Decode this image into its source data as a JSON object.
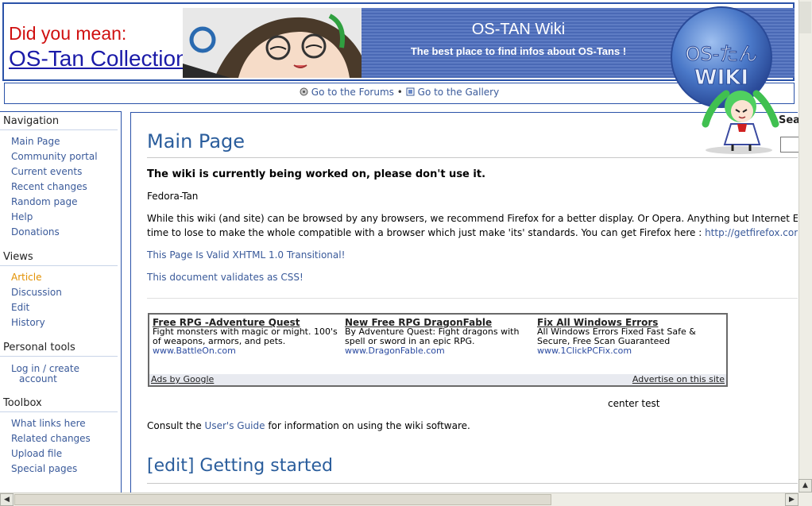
{
  "header": {
    "did_you_mean_label": "Did you mean:",
    "did_you_mean_link": "OS-Tan Collections",
    "site_title": "OS-TAN Wiki",
    "tagline": "The best place to find infos about OS-Tans !",
    "logo_text_line1": "OS-たん",
    "logo_text_line2": "WIKI"
  },
  "linkbar": {
    "forums_link": "Go to the Forums",
    "separator": "•",
    "gallery_link": "Go to the Gallery"
  },
  "sidebar": {
    "navigation": {
      "heading": "Navigation",
      "items": [
        "Main Page",
        "Community portal",
        "Current events",
        "Recent changes",
        "Random page",
        "Help",
        "Donations"
      ]
    },
    "views": {
      "heading": "Views",
      "items": [
        "Article",
        "Discussion",
        "Edit",
        "History"
      ]
    },
    "personal_tools": {
      "heading": "Personal tools",
      "login_line1": "Log in / create",
      "login_line2": "account"
    },
    "toolbox": {
      "heading": "Toolbox",
      "items": [
        "What links here",
        "Related changes",
        "Upload file",
        "Special pages"
      ]
    }
  },
  "search": {
    "label": "Sea"
  },
  "content": {
    "title": "Main Page",
    "warning": "The wiki is currently being worked on, please don't use it.",
    "fedora": "Fedora-Tan",
    "browser_line1": "While this wiki (and site) can be browsed by any browsers, we recommend Firefox for a better display. Or Opera. Anything but Internet Explor",
    "browser_line2_prefix": "time to lose to make the whole compatible with a browser which just make 'its' standards. You can get Firefox here : ",
    "firefox_link": "http://getfirefox.com",
    "xhtml_link": "This Page Is Valid XHTML 1.0 Transitional!",
    "css_link": "This document validates as CSS!",
    "ads": [
      {
        "title": "Free RPG -Adventure Quest",
        "body": "Fight monsters with magic or might. 100's of weapons, armors, and pets.",
        "url": "www.BattleOn.com"
      },
      {
        "title": "New Free RPG DragonFable",
        "body": "By Adventure Quest: Fight dragons with spell or sword in an epic RPG.",
        "url": "www.DragonFable.com"
      },
      {
        "title": "Fix All Windows Errors",
        "body": "All Windows Errors Fixed Fast Safe & Secure, Free Scan Guaranteed",
        "url": "www.1ClickPCFix.com"
      }
    ],
    "ads_by": "Ads by Google",
    "advertise": "Advertise on this site",
    "center_test": "center test",
    "consult_prefix": "Consult the ",
    "users_guide_link": "User's Guide",
    "consult_suffix": " for information on using the wiki software.",
    "section_edit": "[edit]",
    "section_title": "Getting started"
  },
  "scrollbar": {
    "up_arrow": "▲",
    "left_arrow": "◀",
    "right_arrow": "▶"
  },
  "colors": {
    "banner_blue": "#4a69b5",
    "link": "#3a5a9a",
    "active_link": "#e29000",
    "title_blue": "#2a5d9c"
  }
}
